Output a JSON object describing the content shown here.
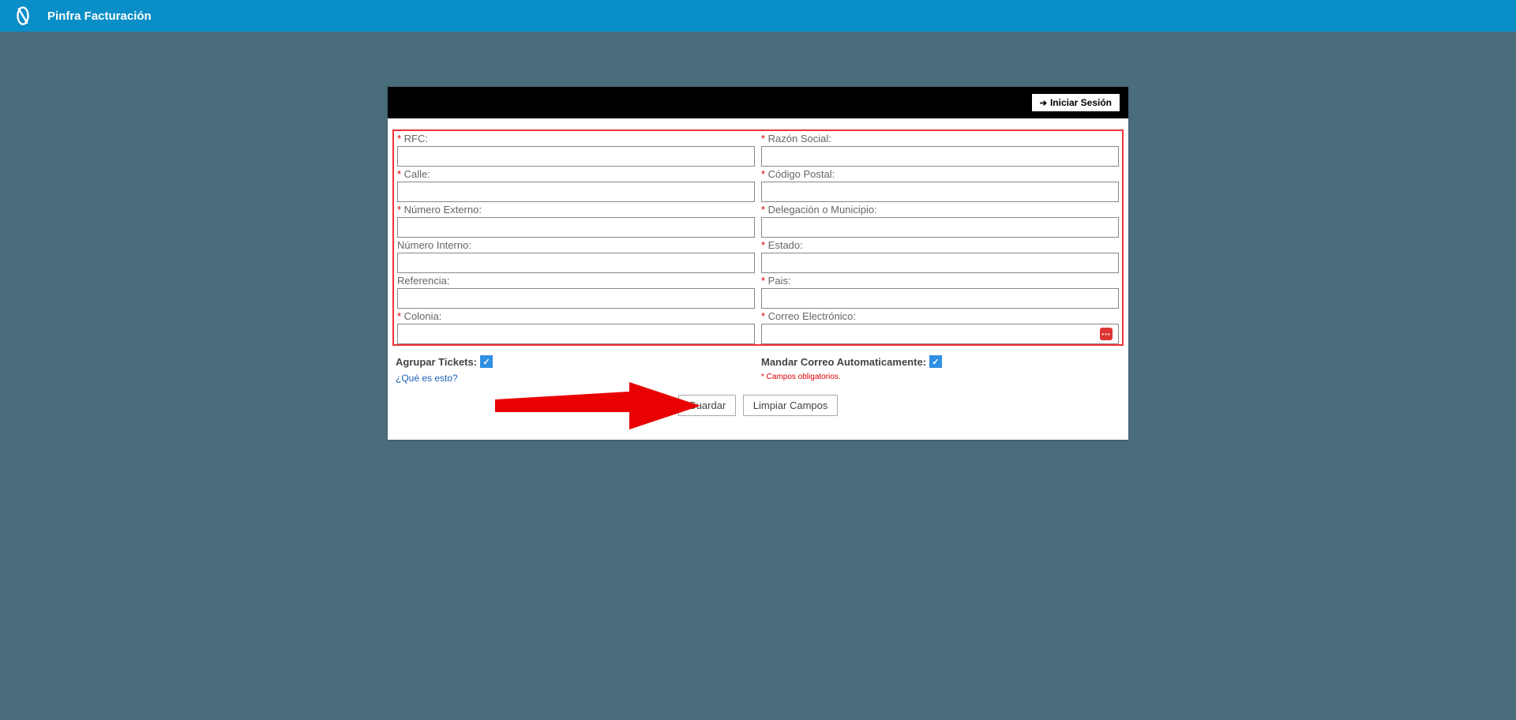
{
  "header": {
    "app_title": "Pinfra Facturación"
  },
  "blackbar": {
    "login_label": "Iniciar Sesión"
  },
  "form": {
    "left": [
      {
        "label": "RFC:",
        "required": true,
        "key": "rfc"
      },
      {
        "label": "Calle:",
        "required": true,
        "key": "calle"
      },
      {
        "label": "Número Externo:",
        "required": true,
        "key": "numext"
      },
      {
        "label": "Número Interno:",
        "required": false,
        "key": "numint"
      },
      {
        "label": "Referencia:",
        "required": false,
        "key": "ref"
      },
      {
        "label": "Colonia:",
        "required": true,
        "key": "colonia"
      }
    ],
    "right": [
      {
        "label": "Razón Social:",
        "required": true,
        "key": "razon"
      },
      {
        "label": "Código Postal:",
        "required": true,
        "key": "cp"
      },
      {
        "label": "Delegación o Municipio:",
        "required": true,
        "key": "deleg"
      },
      {
        "label": "Estado:",
        "required": true,
        "key": "estado"
      },
      {
        "label": "Pais:",
        "required": true,
        "key": "pais"
      },
      {
        "label": "Correo Electrónico:",
        "required": true,
        "key": "correo",
        "email_badge": true
      }
    ]
  },
  "below": {
    "agrupar_label": "Agrupar Tickets:",
    "agrupar_checked": true,
    "help_link": "¿Qué es esto?",
    "auto_label": "Mandar Correo Automaticamente:",
    "auto_checked": true,
    "required_note": "* Campos obligatorios."
  },
  "actions": {
    "guardar": "Guardar",
    "limpiar": "Limpiar Campos"
  }
}
